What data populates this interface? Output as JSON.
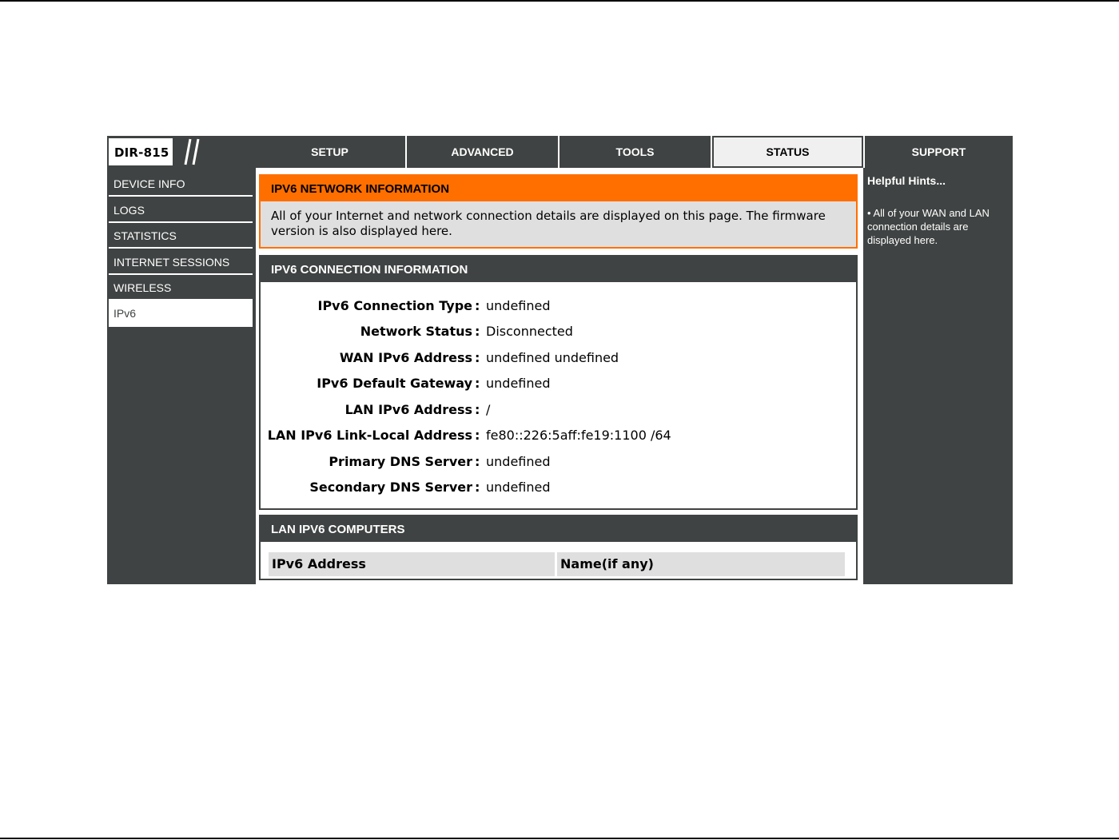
{
  "logo": {
    "model": "DIR-815"
  },
  "tabs": [
    {
      "label": "SETUP"
    },
    {
      "label": "ADVANCED"
    },
    {
      "label": "TOOLS"
    },
    {
      "label": "STATUS",
      "active": true
    },
    {
      "label": "SUPPORT"
    }
  ],
  "sidebar": {
    "items": [
      {
        "label": "DEVICE INFO"
      },
      {
        "label": "LOGS"
      },
      {
        "label": "STATISTICS"
      },
      {
        "label": "INTERNET SESSIONS"
      },
      {
        "label": "WIRELESS"
      },
      {
        "label": "IPv6",
        "active": true
      }
    ]
  },
  "network_info": {
    "title": "IPV6 NETWORK INFORMATION",
    "description": "All of your Internet and network connection details are displayed on this page. The firmware version is also displayed here."
  },
  "connection_info": {
    "title": "IPV6 CONNECTION INFORMATION",
    "separator": ":",
    "rows": [
      {
        "label": "IPv6 Connection Type",
        "value": "undefined"
      },
      {
        "label": "Network Status",
        "value": "Disconnected"
      },
      {
        "label": "WAN IPv6 Address",
        "value": "undefined undefined"
      },
      {
        "label": "IPv6 Default Gateway",
        "value": "undefined"
      },
      {
        "label": "LAN IPv6 Address",
        "value": "/"
      },
      {
        "label": "LAN IPv6 Link-Local Address",
        "value": "fe80::226:5aff:fe19:1100 /64"
      },
      {
        "label": "Primary DNS Server",
        "value": "undefined"
      },
      {
        "label": "Secondary DNS Server",
        "value": "undefined"
      }
    ]
  },
  "lan_computers": {
    "title": "LAN IPV6 COMPUTERS",
    "columns": [
      "IPv6 Address",
      "Name(if any)"
    ]
  },
  "hints": {
    "title": "Helpful Hints...",
    "text": "• All of your WAN and LAN connection details are displayed here."
  },
  "colors": {
    "dark": "#404343",
    "accent": "#ff6f00",
    "light_gray": "#dfdfdf"
  }
}
